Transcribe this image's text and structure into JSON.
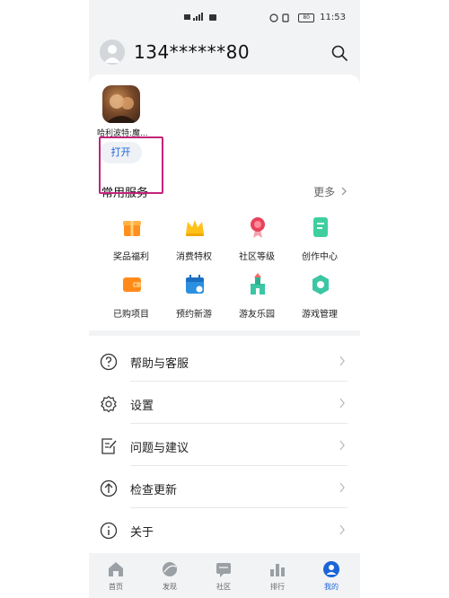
{
  "status_bar": {
    "time": "11:53",
    "battery": "80"
  },
  "header": {
    "phone_number": "134******80"
  },
  "recent_app": {
    "name": "哈利波特:魔...",
    "open_label": "打开"
  },
  "services": {
    "title": "常用服务",
    "more_label": "更多",
    "items": [
      {
        "label": "奖品福利",
        "icon": "gift-icon"
      },
      {
        "label": "消费特权",
        "icon": "crown-icon"
      },
      {
        "label": "社区等级",
        "icon": "medal-icon"
      },
      {
        "label": "创作中心",
        "icon": "document-icon"
      },
      {
        "label": "已购项目",
        "icon": "wallet-icon"
      },
      {
        "label": "预约新游",
        "icon": "calendar-icon"
      },
      {
        "label": "游友乐园",
        "icon": "castle-icon"
      },
      {
        "label": "游戏管理",
        "icon": "gear-icon"
      }
    ]
  },
  "settings_list": [
    {
      "label": "帮助与客服",
      "icon": "help-icon"
    },
    {
      "label": "设置",
      "icon": "settings-icon"
    },
    {
      "label": "问题与建议",
      "icon": "feedback-icon"
    },
    {
      "label": "检查更新",
      "icon": "update-icon"
    },
    {
      "label": "关于",
      "icon": "info-icon"
    }
  ],
  "tabs": [
    {
      "label": "首页",
      "icon": "home-icon"
    },
    {
      "label": "发现",
      "icon": "discover-icon"
    },
    {
      "label": "社区",
      "icon": "community-icon"
    },
    {
      "label": "排行",
      "icon": "ranking-icon"
    },
    {
      "label": "我的",
      "icon": "profile-icon",
      "active": true
    }
  ],
  "colors": {
    "accent": "#1b64d8",
    "highlight": "#c4237a",
    "background": "#f1f3f5"
  }
}
